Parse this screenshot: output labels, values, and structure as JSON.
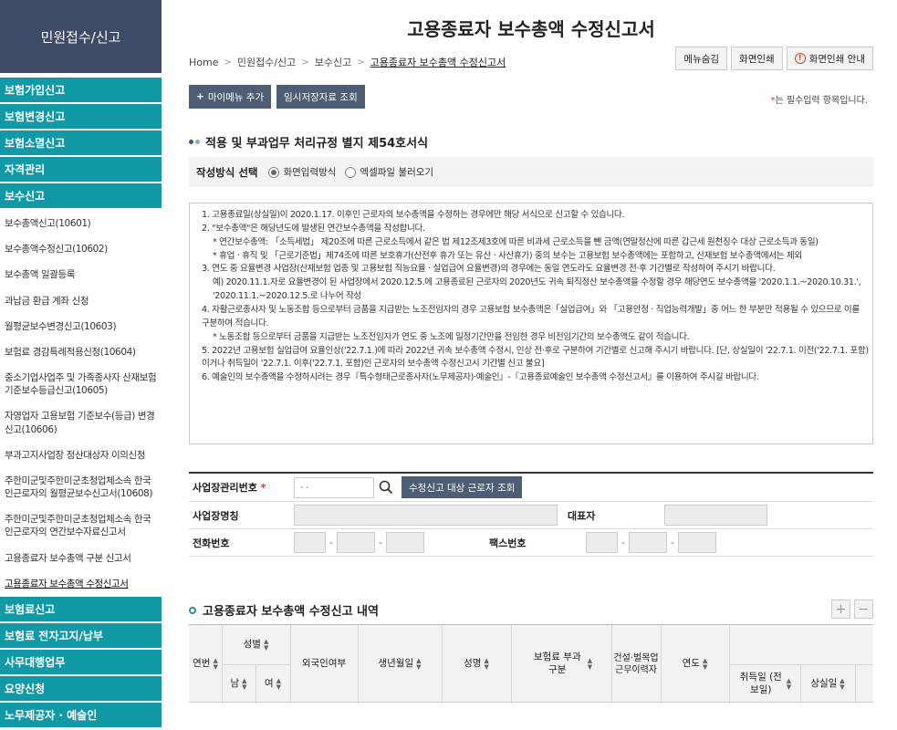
{
  "sidebar": {
    "title": "민원접수/신고",
    "items": [
      {
        "label": "보험가입신고",
        "type": "main"
      },
      {
        "label": "보험변경신고",
        "type": "main"
      },
      {
        "label": "보험소멸신고",
        "type": "main"
      },
      {
        "label": "자격관리",
        "type": "main"
      },
      {
        "label": "보수신고",
        "type": "main"
      }
    ],
    "subs": [
      "보수총액신고(10601)",
      "보수총액수정신고(10602)",
      "보수총액 일괄등록",
      "과납금 환급 계좌 신청",
      "월평균보수변경신고(10603)",
      "보험료 경감특례적용신청(10604)",
      "중소기업사업주 및 가족종사자 산재보험 기준보수등급신고(10605)",
      "자영업자 고용보험 기준보수(등급) 변경신고(10606)",
      "부과고지사업장 정산대상자 이의신청",
      "주한미군및주한미군초청업체소속 한국인근로자의 월평균보수신고서(10608)",
      "주한미군및주한미군초청업체소속 한국인근로자의 연간보수자료신고서",
      "고용종료자 보수총액 구분 신고서",
      "고용종료자 보수총액 수정신고서"
    ],
    "bottom": [
      "보험료신고",
      "보험료 전자고지/납부",
      "사무대행업무",
      "요양신청",
      "노무제공자 · 예술인"
    ]
  },
  "page": {
    "title": "고용종료자 보수총액 수정신고서",
    "breadcrumb": [
      "Home",
      "민원접수/신고",
      "보수신고",
      "고용종료자 보수총액 수정신고서"
    ],
    "top_buttons": {
      "menu_hide": "메뉴숨김",
      "print": "화면인쇄",
      "print_guide": "화면인쇄 안내"
    },
    "add_menu": "마이메뉴 추가",
    "temp_saved": "임시저장자료 조회",
    "required_note_star": "*",
    "required_note": "는 필수입력 항목입니다."
  },
  "form": {
    "heading": "적용 및 부과업무 처리규정 별지 제54호서식",
    "method_label": "작성방식 선택",
    "method_options": [
      "화면입력방식",
      "엑셀파일 불러오기"
    ],
    "method_selected": "화면입력방식"
  },
  "notice": [
    "1. 고용종료일(상실일)이 2020.1.17. 이후인 근로자의 보수총액을 수정하는 경우에만 해당 서식으로 신고할 수 있습니다.",
    "2. \"보수총액\"은 해당년도에 발생된 연간보수총액을 작성합니다.",
    "* 연간보수총액: 「소득세법」 제20조에 따른 근로소득에서 같은 법 제12조제3호에 따른 비과세 근로소득을 뺀 금액(연말정산에 따른 갑근세 원천징수 대상 근로소득과 동일)",
    "* 휴업 · 휴직 및 「근로기준법」제74조에 따른 보호휴가(산전후 휴가 또는 유산 · 사산휴가) 중의 보수는 고용보험 보수총액에는 포함하고, 산재보험 보수총액에서는 제외",
    "3. 연도 중 요율변경 사업장(산재보험 업종 및 고용보험 직능요율 · 실업급여 요율변경)의 경우에는 동일 연도라도 요율변경 전·후 기간별로 작성하여 주시기 바랍니다.",
    "예) 2020.11.1.자로 요율변경이 된 사업장에서 2020.12.5.에 고용종료된 근로자의 2020년도 귀속 퇴직정산 보수총액을 수정할 경우 해당연도 보수총액을 '2020.1.1.~2020.10.31.', '2020.11.1.~2020.12.5.로 나누어 작성",
    "4. 자활근로종사자 및 노동조합 등으로부터 금품을 지급받는 노조전임자의 경우 고용보험 보수총액은「실업급여」와 「고용안정 · 직업능력개발」중 어느 한 부분만 적용될 수 있으므로 이를 구분하여 적습니다.",
    "* 노동조합 등으로부터 금품을 지급받는 노조전임자가 연도 중 노조에 일정기간만을 전임한 경우 비전임기간의 보수총액도 같이 적습니다.",
    "5. 2022년 고용보험 실업급여 요율인상('22.7.1.)에 따라 2022년 귀속 보수총액 수정시, 인상 전·후로 구분하여 기간별로 신고해 주시기 바랍니다. [단, 상실일이 '22.7.1. 이전('22.7.1. 포함)이거나 취득일이 '22.7.1. 이후('22.7.1. 포함)인 근로자의 보수총액 수정신고시 기간별 신고 불요]",
    "6. 예술인의 보수총액을 수정하시려는 경우『특수형태근로종사자(노무제공자)·예술인』-『고용종료예술인 보수총액 수정신고서』를 이용하여 주시길 바랍니다."
  ],
  "business": {
    "reg_no_label": "사업장관리번호",
    "reg_no_star": "*",
    "reg_no_placeholder": "- -",
    "lookup_button": "수정신고 대상 근로자 조회",
    "name_label": "사업장명칭",
    "rep_label": "대표자",
    "phone_label": "전화번호",
    "fax_label": "팩스번호"
  },
  "detail": {
    "heading": "고용종료자 보수총액 수정신고 내역",
    "plus": "+",
    "minus": "−",
    "columns": {
      "seq": "연번",
      "gender": "성별",
      "male": "남",
      "female": "여",
      "foreign": "외국인여부",
      "birth": "생년월일",
      "name": "성명",
      "premium": "보험료 부과구분",
      "construction": "건설·벌목업 근무이력자",
      "year": "연도",
      "acq": "취득일 (전보일)",
      "loss": "상실일"
    }
  }
}
